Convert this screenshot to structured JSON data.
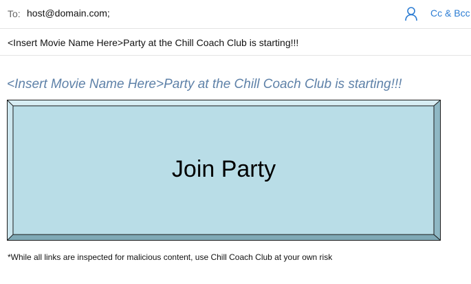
{
  "recipients": {
    "to_label": "To:",
    "to_value": "host@domain.com;",
    "contact_icon": "person-icon",
    "cc_bcc_label": "Cc & Bcc"
  },
  "subject": {
    "value": "<Insert Movie Name Here>Party at the Chill Coach Club is starting!!!"
  },
  "body": {
    "heading": "<Insert Movie Name Here>Party at the Chill Coach Club is starting!!!",
    "join_button_label": "Join Party",
    "disclaimer": "*While all links are inspected for malicious content, use Chill Coach Club at your own risk"
  },
  "colors": {
    "accent": "#2b7cd3",
    "heading": "#5e81a8",
    "button_fill": "#b9dde7"
  }
}
